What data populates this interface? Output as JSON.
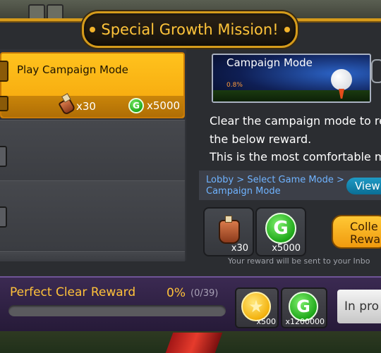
{
  "title": "Special Growth Mission!",
  "missions": [
    {
      "label": "Play Campaign Mode",
      "rewards": [
        {
          "icon": "potion-icon",
          "qty": "x30"
        },
        {
          "icon": "g-coin-icon",
          "qty": "x5000"
        }
      ]
    }
  ],
  "detail": {
    "banner_title": "Campaign Mode",
    "banner_percent": "0.8%",
    "description": [
      "Clear the campaign mode to re",
      "the below reward.",
      "This is the most comfortable m"
    ],
    "path_line1": "Lobby > Select Game Mode >",
    "path_line2": "Campaign Mode",
    "view_label": "View",
    "rewards": [
      {
        "icon": "potion-icon",
        "qty": "x30"
      },
      {
        "icon": "g-coin-icon",
        "qty": "x5000"
      }
    ],
    "collect_label_1": "Colle",
    "collect_label_2": "Rewa",
    "notice": "Your reward will be sent to your Inbo"
  },
  "perfect_clear": {
    "title": "Perfect Clear Reward",
    "percent": "0%",
    "count": "(0/39)",
    "progress_fraction": 0,
    "rewards": [
      {
        "icon": "star-coin-icon",
        "qty": "x500"
      },
      {
        "icon": "g-coin-icon",
        "qty": "x1200000"
      }
    ],
    "status_label": "In pro"
  },
  "colors": {
    "accent": "#ffc23a",
    "panel": "#2b2d31",
    "highlight": "#f4a40b",
    "footer": "#3b2a52"
  }
}
